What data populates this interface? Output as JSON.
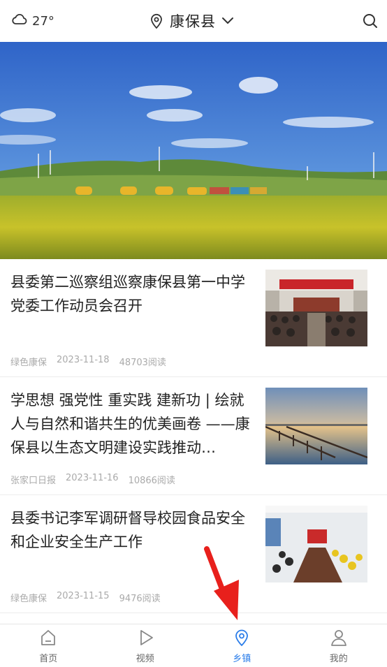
{
  "header": {
    "weather_icon": "cloud-icon",
    "temperature": "27°",
    "location": "康保县",
    "location_icon": "location-pin-icon",
    "dropdown_icon": "chevron-down-icon",
    "search_icon": "search-icon"
  },
  "banner": {
    "image": "landscape photo of green hills, wind turbines and cabins beside a yellow rapeseed field"
  },
  "news": [
    {
      "title": "县委第二巡察组巡察康保县第一中学党委工作动员会召开",
      "source": "绿色康保",
      "date": "2023-11-18",
      "reads": "48703阅读",
      "thumbnail": "meeting-hall-photo"
    },
    {
      "title": "学思想 强党性 重实践 建新功 | 绘就人与自然和谐共生的优美画卷 ——康保县以生态文明建设实践推动…",
      "source": "张家口日报",
      "date": "2023-11-16",
      "reads": "10866阅读",
      "thumbnail": "lake-boardwalk-photo"
    },
    {
      "title": "县委书记李军调研督导校园食品安全和企业安全生产工作",
      "source": "绿色康保",
      "date": "2023-11-15",
      "reads": "9476阅读",
      "thumbnail": "conference-room-photo"
    }
  ],
  "tabbar": {
    "active_color": "#2b7de9",
    "tabs": [
      {
        "label": "首页",
        "icon": "home-icon"
      },
      {
        "label": "视频",
        "icon": "play-icon"
      },
      {
        "label": "乡镇",
        "icon": "location-pin-icon"
      },
      {
        "label": "我的",
        "icon": "user-icon"
      }
    ]
  },
  "annotation": {
    "arrow_color": "#e8201c",
    "arrow_icon": "red-arrow-pointer"
  }
}
